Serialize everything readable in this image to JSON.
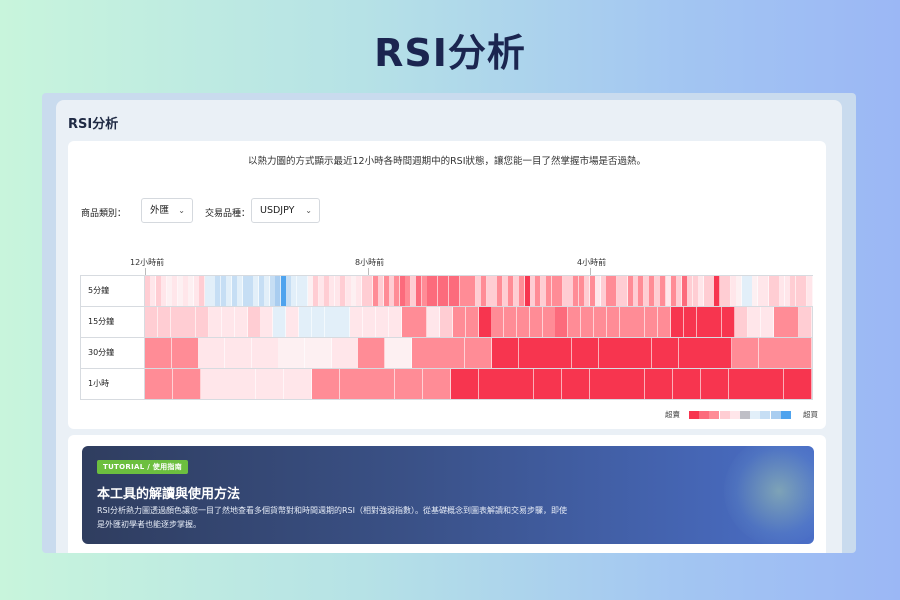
{
  "page": {
    "heading": "RSI分析"
  },
  "panel": {
    "title": "RSI分析",
    "description": "以熱力圖的方式顯示最近12小時各時間週期中的RSI狀態，讓您能一目了然掌握市場是否過熱。"
  },
  "filters": {
    "category_label": "商品類別：",
    "category_value": "外匯",
    "symbol_label": "交易品種：",
    "symbol_value": "USDJPY"
  },
  "chart_data": {
    "type": "heatmap",
    "x_labels": [
      "12小時前",
      "8小時前",
      "4小時前"
    ],
    "rows": [
      {
        "label": "5分鐘",
        "values": [
          2,
          1,
          2,
          1,
          0,
          1,
          0,
          1,
          0,
          1,
          2,
          -1,
          -1,
          -2,
          -2,
          -1,
          -2,
          -1,
          -2,
          -2,
          -1,
          -2,
          -1,
          -2,
          -3,
          -4,
          -2,
          -1,
          -1,
          -1,
          0,
          2,
          1,
          2,
          1,
          1,
          2,
          1,
          0,
          1,
          2,
          2,
          3,
          2,
          3,
          2,
          3,
          4,
          3,
          2,
          4,
          3,
          4,
          4,
          4,
          4,
          4,
          4,
          3,
          3,
          3,
          2,
          3,
          2,
          2,
          3,
          2,
          3,
          2,
          3,
          5,
          2,
          3,
          2,
          3,
          3,
          3,
          2,
          2,
          3,
          3,
          2,
          3,
          1,
          2,
          3,
          3,
          2,
          2,
          3,
          2,
          3,
          2,
          3,
          2,
          3,
          1,
          3,
          2,
          4,
          2,
          2,
          1,
          2,
          2,
          5,
          2,
          2,
          1,
          0,
          -1,
          -1,
          0,
          1,
          1,
          2,
          2,
          1,
          1,
          2,
          2,
          2,
          1
        ]
      },
      {
        "label": "15分鐘",
        "values": [
          2,
          2,
          2,
          2,
          2,
          1,
          1,
          1,
          2,
          1,
          -1,
          1,
          -1,
          -1,
          -1,
          -1,
          1,
          1,
          1,
          1,
          3,
          3,
          1,
          2,
          3,
          3,
          5,
          3,
          3,
          3,
          3,
          3,
          4,
          3,
          3,
          3,
          3,
          3,
          3,
          3,
          3,
          5,
          5,
          5,
          5,
          5,
          2,
          1,
          1,
          3,
          3,
          2
        ]
      },
      {
        "label": "30分鐘",
        "values": [
          3,
          3,
          1,
          1,
          1,
          0,
          0,
          1,
          3,
          0,
          3,
          3,
          3,
          5,
          5,
          5,
          5,
          5,
          5,
          5,
          5,
          5,
          3,
          3,
          3
        ]
      },
      {
        "label": "1小時",
        "values": [
          3,
          3,
          1,
          1,
          1,
          1,
          3,
          3,
          3,
          3,
          3,
          5,
          5,
          5,
          5,
          5,
          5,
          5,
          5,
          5,
          5,
          5,
          5,
          5
        ]
      }
    ],
    "legend": {
      "left": "超賣",
      "right": "超買"
    },
    "colors": {
      "5": "#f7354f",
      "4": "#fc6b7c",
      "3": "#ff8c96",
      "2": "#ffcdd3",
      "1": "#ffe6ea",
      "0": "#fdf0f2",
      "-1": "#e2eff9",
      "-2": "#c6def4",
      "-3": "#a9cdf0",
      "-4": "#4ea3ee"
    },
    "legend_colors": [
      "#f7354f",
      "#fc6b7c",
      "#ff8c96",
      "#ffcdd3",
      "#ffe6ea",
      "#bfbfc6",
      "#e2eff9",
      "#c6def4",
      "#a9cdf0",
      "#4ea3ee"
    ]
  },
  "guide": {
    "badge": "TUTORIAL / 使用指南",
    "title": "本工具的解讀與使用方法",
    "text": "RSI分析熱力圖透過顏色讓您一目了然地查看多個貨幣對和時間週期的RSI（相對強弱指數）。從基礎概念到圖表解讀和交易步驟，即使是外匯初學者也能逐步掌握。"
  }
}
